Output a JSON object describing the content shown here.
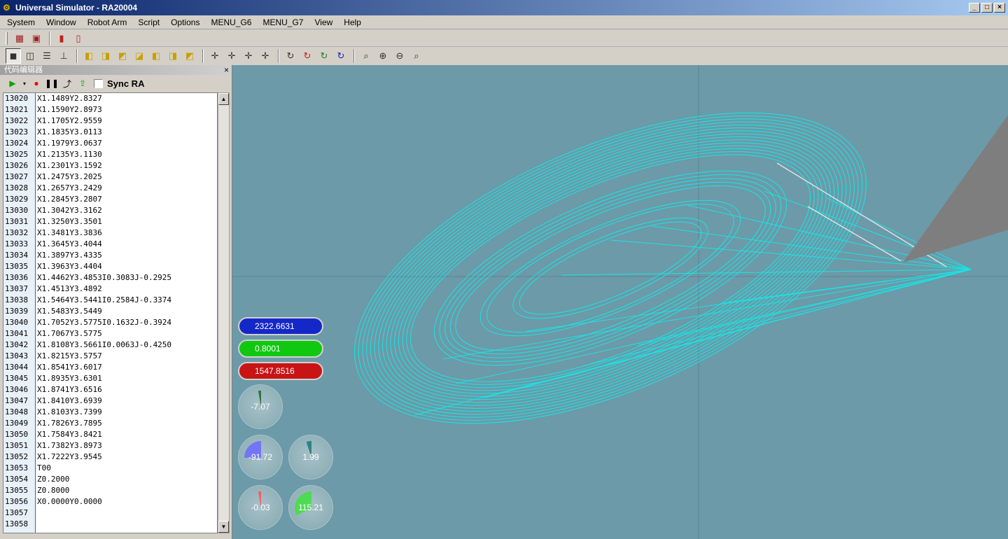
{
  "window": {
    "title": "Universal Simulator - RA20004",
    "minimize": "_",
    "maximize": "□",
    "close": "×"
  },
  "menubar": [
    "System",
    "Window",
    "Robot Arm",
    "Script",
    "Options",
    "MENU_G6",
    "MENU_G7",
    "View",
    "Help"
  ],
  "editor": {
    "title": "代码编辑器",
    "close": "×",
    "sync_label": "Sync RA",
    "lines": [
      {
        "n": "13020",
        "t": "X1.1489Y2.8327"
      },
      {
        "n": "13021",
        "t": "X1.1590Y2.8973"
      },
      {
        "n": "13022",
        "t": "X1.1705Y2.9559"
      },
      {
        "n": "13023",
        "t": "X1.1835Y3.0113"
      },
      {
        "n": "13024",
        "t": "X1.1979Y3.0637"
      },
      {
        "n": "13025",
        "t": "X1.2135Y3.1130"
      },
      {
        "n": "13026",
        "t": "X1.2301Y3.1592"
      },
      {
        "n": "13027",
        "t": "X1.2475Y3.2025"
      },
      {
        "n": "13028",
        "t": "X1.2657Y3.2429"
      },
      {
        "n": "13029",
        "t": "X1.2845Y3.2807"
      },
      {
        "n": "13030",
        "t": "X1.3042Y3.3162"
      },
      {
        "n": "13031",
        "t": "X1.3250Y3.3501"
      },
      {
        "n": "13032",
        "t": "X1.3481Y3.3836"
      },
      {
        "n": "13033",
        "t": "X1.3645Y3.4044"
      },
      {
        "n": "13034",
        "t": "X1.3897Y3.4335"
      },
      {
        "n": "13035",
        "t": "X1.3963Y3.4404"
      },
      {
        "n": "13036",
        "t": "X1.4462Y3.4853I0.3083J-0.2925"
      },
      {
        "n": "13037",
        "t": "X1.4513Y3.4892"
      },
      {
        "n": "13038",
        "t": "X1.5464Y3.5441I0.2584J-0.3374"
      },
      {
        "n": "13039",
        "t": "X1.5483Y3.5449"
      },
      {
        "n": "13040",
        "t": "X1.7052Y3.5775I0.1632J-0.3924"
      },
      {
        "n": "13041",
        "t": "X1.7067Y3.5775"
      },
      {
        "n": "13042",
        "t": "X1.8108Y3.5661I0.0063J-0.4250"
      },
      {
        "n": "13043",
        "t": "X1.8215Y3.5757"
      },
      {
        "n": "13044",
        "t": "X1.8541Y3.6017"
      },
      {
        "n": "13045",
        "t": "X1.8935Y3.6301"
      },
      {
        "n": "13046",
        "t": "X1.8741Y3.6516"
      },
      {
        "n": "13047",
        "t": "X1.8410Y3.6939"
      },
      {
        "n": "13048",
        "t": "X1.8103Y3.7399"
      },
      {
        "n": "13049",
        "t": "X1.7826Y3.7895"
      },
      {
        "n": "13050",
        "t": "X1.7584Y3.8421"
      },
      {
        "n": "13051",
        "t": "X1.7382Y3.8973"
      },
      {
        "n": "13052",
        "t": "X1.7222Y3.9545"
      },
      {
        "n": "13053",
        "t": "T00"
      },
      {
        "n": "13054",
        "t": "Z0.2000"
      },
      {
        "n": "13055",
        "t": "Z0.8000"
      },
      {
        "n": "13056",
        "t": "X0.0000Y0.0000"
      },
      {
        "n": "13057",
        "t": ""
      },
      {
        "n": "13058",
        "t": ""
      }
    ]
  },
  "readouts": {
    "x": {
      "value": "2322.6631",
      "color": "#1428c8"
    },
    "y": {
      "value": "0.8001",
      "color": "#10c810"
    },
    "z": {
      "value": "1547.8516",
      "color": "#c81414"
    }
  },
  "gauges": [
    {
      "value": "-7.07",
      "color": "#1a6a2a",
      "fraction": 0.02
    },
    {
      "value": "-91.72",
      "color": "#6a6aff",
      "fraction": 0.25
    },
    {
      "value": "1.99",
      "color": "#1a7a7a",
      "fraction": 0.05
    },
    {
      "value": "-0.03",
      "color": "#ff5050",
      "fraction": 0.01
    },
    {
      "value": "115.21",
      "color": "#40e040",
      "fraction": 0.32
    }
  ]
}
